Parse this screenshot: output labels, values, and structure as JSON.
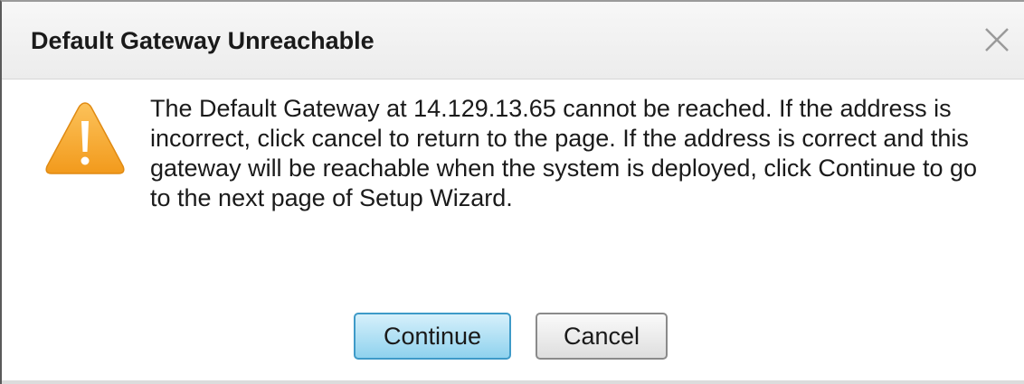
{
  "dialog": {
    "title": "Default Gateway Unreachable",
    "close_icon": "close-icon",
    "warning_icon": "warning-icon",
    "message": "The Default Gateway at 14.129.13.65 cannot be reached. If the address is incorrect, click cancel to return to the page. If the address is correct and this gateway will be reachable when the system is deployed, click Continue to go to the next page of Setup Wizard.",
    "buttons": {
      "continue_label": "Continue",
      "cancel_label": "Cancel"
    }
  },
  "colors": {
    "warning": "#f5a623",
    "primary_button": "#8fd2ee",
    "primary_border": "#3e9ac8"
  }
}
